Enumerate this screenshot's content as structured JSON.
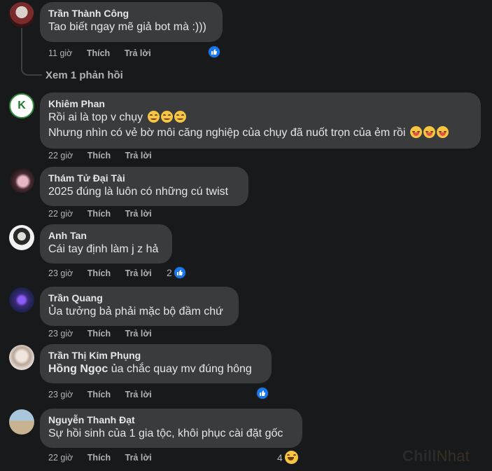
{
  "labels": {
    "like": "Thích",
    "reply": "Trả lời"
  },
  "colors": {
    "background": "#18191a",
    "bubble": "#3a3b3c",
    "like_blue": "#1877f2",
    "muted_text": "#b0b3b8"
  },
  "view_replies": "Xem 1 phản hồi",
  "comments": [
    {
      "author": "Trần Thành Công",
      "lines": [
        "Tao biết ngay mẽ giả bot mà :)))"
      ],
      "time": "11 giờ",
      "reactions": {
        "icons": [
          "like-icon"
        ],
        "count": ""
      }
    },
    {
      "author": "Khiêm Phan",
      "lines": [
        "Rồi ai là top v chụy",
        "Nhưng nhìn có vẻ bờ môi căng nghiệp của chụy đã nuốt trọn của ẻm rồi"
      ],
      "time": "22 giờ",
      "avatar_letter": "K"
    },
    {
      "author": "Thám Tử Đại Tài",
      "lines": [
        "2025 đúng là luôn có những cú twist"
      ],
      "time": "22 giờ"
    },
    {
      "author": "Anh Tan",
      "lines": [
        "Cái tay định làm j z hả"
      ],
      "time": "23 giờ",
      "reactions": {
        "icons": [
          "like-icon"
        ],
        "count": "2"
      }
    },
    {
      "author": "Trần Quang",
      "lines": [
        "Ủa tưởng bả phải mặc bộ đầm chứ"
      ],
      "time": "23 giờ"
    },
    {
      "author": "Trần Thị Kim Phụng",
      "mention": "Hồng Ngọc",
      "lines": [
        " ủa chắc quay mv đúng hông"
      ],
      "time": "23 giờ",
      "reactions": {
        "icons": [
          "like-icon"
        ],
        "count": ""
      }
    },
    {
      "author": "Nguyễn Thanh Đạt",
      "lines": [
        "Sự hồi sinh của 1 gia tộc, khôi phục cài đặt gốc"
      ],
      "time": "22 giờ",
      "reactions": {
        "icons": [
          "laugh-emoji-icon"
        ],
        "count": "4"
      }
    }
  ],
  "watermark": {
    "part1": "Chill",
    "part2": "Nhat"
  }
}
